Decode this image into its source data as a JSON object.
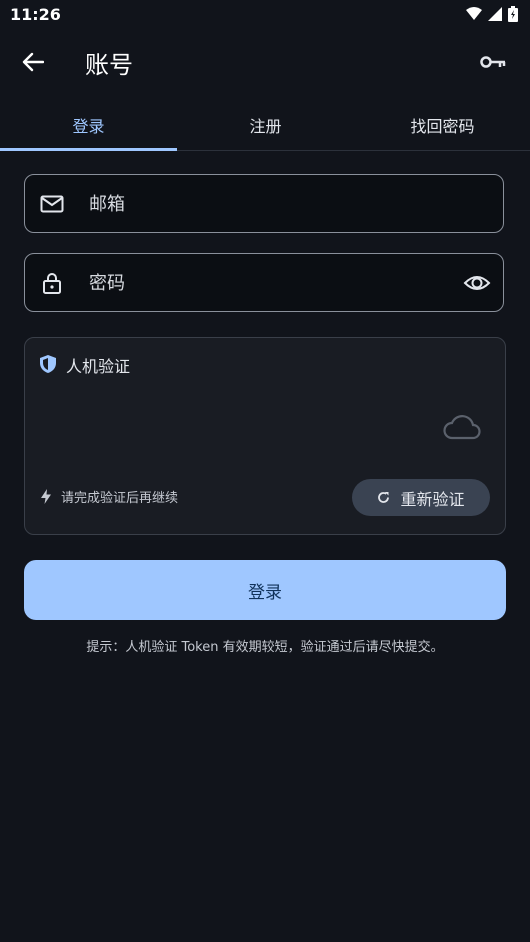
{
  "status_bar": {
    "time": "11:26",
    "icons": [
      "wifi-icon",
      "signal-icon",
      "battery-icon"
    ]
  },
  "app_bar": {
    "title": "账号",
    "back_icon": "arrow-left-icon",
    "action_icon": "key-icon"
  },
  "tabs": [
    {
      "label": "登录",
      "active": true
    },
    {
      "label": "注册",
      "active": false
    },
    {
      "label": "找回密码",
      "active": false
    }
  ],
  "form": {
    "email": {
      "placeholder": "邮箱",
      "value": "",
      "icon": "mail-icon"
    },
    "password": {
      "placeholder": "密码",
      "value": "",
      "icon": "lock-icon",
      "toggle_icon": "eye-icon"
    }
  },
  "captcha": {
    "title": "人机验证",
    "title_icon": "shield-icon",
    "status_icon": "cloud-icon",
    "hint": "请完成验证后再继续",
    "hint_icon": "bolt-icon",
    "reverify_label": "重新验证",
    "reverify_icon": "refresh-icon"
  },
  "login_button": {
    "label": "登录"
  },
  "footer_tip": "提示：人机验证 Token 有效期较短，验证通过后请尽快提交。",
  "colors": {
    "background": "#11141b",
    "accent": "#9fc7ff",
    "button_text": "#10325a",
    "captcha_bg": "#191c23",
    "reverify_bg": "#3a4352"
  }
}
